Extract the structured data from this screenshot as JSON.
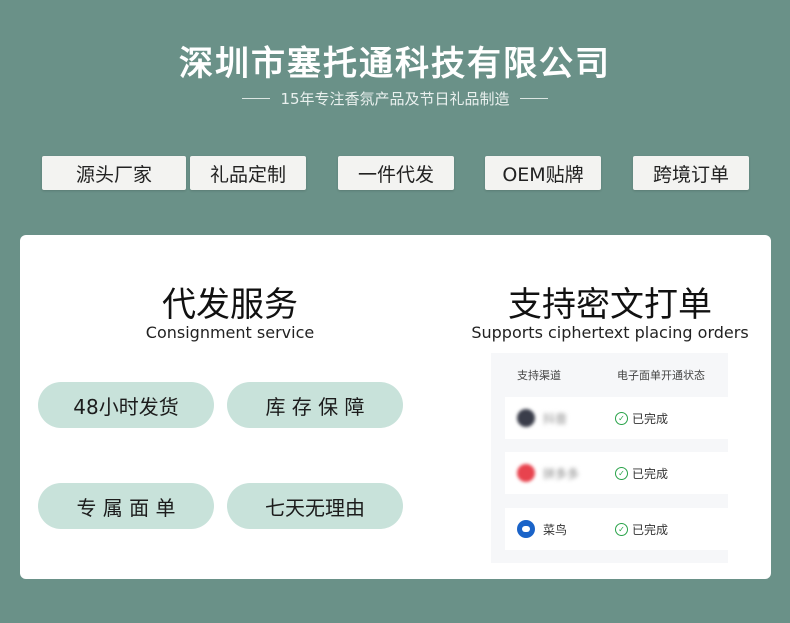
{
  "header": {
    "company": "深圳市塞托通科技有限公司",
    "tagline": "15年专注香氛产品及节日礼品制造"
  },
  "tags": [
    "源头厂家",
    "礼品定制",
    "一件代发",
    "OEM贴牌",
    "跨境订单"
  ],
  "left": {
    "title": "代发服务",
    "subtitle": "Consignment service",
    "pills": [
      "48小时发货",
      "库 存 保 障",
      "专 属 面 单",
      "七天无理由"
    ]
  },
  "right": {
    "title": "支持密文打单",
    "subtitle": "Supports ciphertext placing orders",
    "table": {
      "col1": "支持渠道",
      "col2": "电子面单开通状态",
      "rows": [
        {
          "name": "抖音",
          "status": "已完成",
          "logo": "blurred-logo-icon"
        },
        {
          "name": "拼多多",
          "status": "已完成",
          "logo": "blurred-logo-icon"
        },
        {
          "name": "菜鸟",
          "status": "已完成",
          "logo": "cainiao-logo-icon"
        }
      ]
    }
  }
}
